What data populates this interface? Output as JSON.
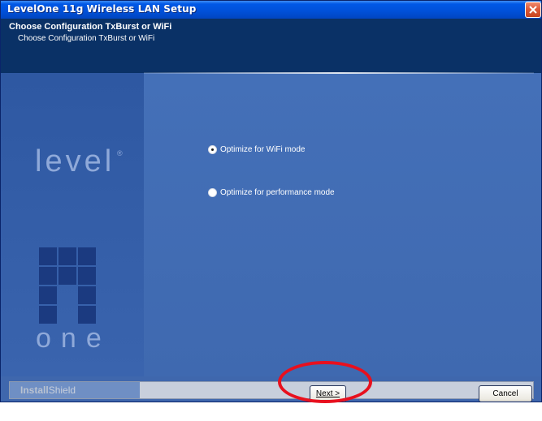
{
  "window": {
    "title": "LevelOne 11g Wireless LAN Setup"
  },
  "header": {
    "title": "Choose Configuration TxBurst or WiFi",
    "subtitle": "Choose Configuration TxBurst or WiFi"
  },
  "logo": {
    "top_text": "level",
    "registered": "®",
    "bottom_text": "one"
  },
  "options": [
    {
      "label": "Optimize for WiFi mode",
      "selected": true
    },
    {
      "label": "Optimize for performance mode",
      "selected": false
    }
  ],
  "footer": {
    "brand_bold": "Install",
    "brand_light": "Shield",
    "next_label": "Next >",
    "cancel_label": "Cancel"
  },
  "icons": {
    "close": "close-icon"
  },
  "colors": {
    "titlebar": "#0058e6",
    "header_bg": "#0a3166",
    "content_bg": "#3f67ad",
    "highlight_ring": "#e8101e"
  }
}
